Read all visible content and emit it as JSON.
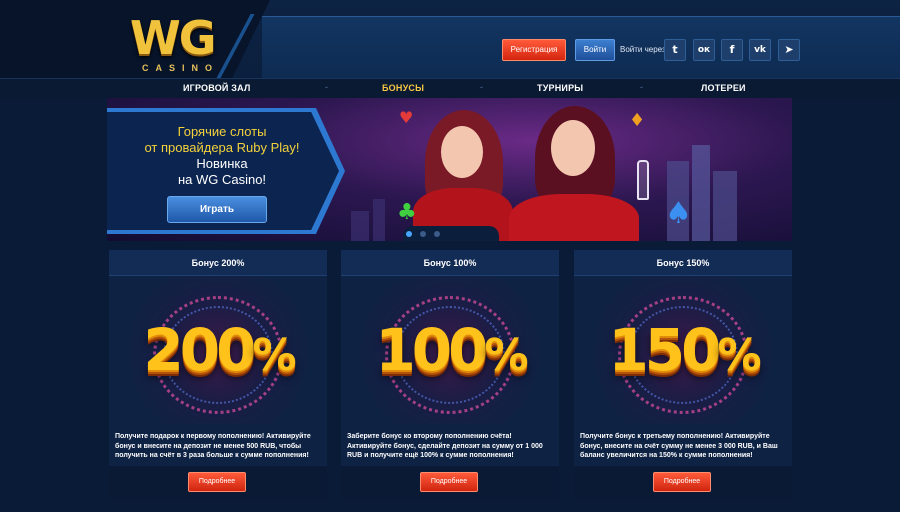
{
  "brand": {
    "logo_main": "WG",
    "logo_sub": "CASINO",
    "gold": "#f1c33d"
  },
  "header": {
    "register_label": "Регистрация",
    "login_label": "Войти",
    "login_via_label": "Войти через",
    "socials": [
      {
        "name": "twitter",
        "glyph": "t"
      },
      {
        "name": "odnoklassniki",
        "glyph": "ок"
      },
      {
        "name": "facebook",
        "glyph": "f"
      },
      {
        "name": "vkontakte",
        "glyph": "vk"
      },
      {
        "name": "telegram",
        "glyph": "➤"
      }
    ]
  },
  "nav": {
    "items": [
      {
        "label": "ИГРОВОЙ ЗАЛ",
        "active": false
      },
      {
        "label": "БОНУСЫ",
        "active": true
      },
      {
        "label": "ТУРНИРЫ",
        "active": false
      },
      {
        "label": "ЛОТЕРЕИ",
        "active": false
      }
    ],
    "separator": "-"
  },
  "banner": {
    "line1": "Горячие слоты",
    "line2": "от провайдера Ruby Play!",
    "line3": "Новинка",
    "line4": "на WG Casino!",
    "play_label": "Играть",
    "slides_count": 3,
    "active_slide": 1
  },
  "bonuses": [
    {
      "title": "Бонус 200%",
      "big_number": "200",
      "big_suffix": "%",
      "text": "Получите подарок к первому пополнению! Активируйте бонус и внесите на депозит не менее 500 RUB, чтобы получить на счёт в 3 раза больше к сумме пополнения!",
      "button": "Подробнее"
    },
    {
      "title": "Бонус 100%",
      "big_number": "100",
      "big_suffix": "%",
      "text": "Заберите бонус ко второму пополнению счёта! Активируйте бонус, сделайте депозит на сумму от 1 000 RUB и получите ещё 100% к сумме пополнения!",
      "button": "Подробнее"
    },
    {
      "title": "Бонус 150%",
      "big_number": "150",
      "big_suffix": "%",
      "text": "Получите бонус к третьему пополнению! Активируйте бонус, внесите на счёт сумму не менее 3 000 RUB, и Ваш баланс увеличится на 150% к сумме пополнения!",
      "button": "Подробнее"
    }
  ],
  "colors": {
    "accent_red": "#e0361c",
    "accent_blue": "#2d6fc4",
    "nav_active": "#f6c744",
    "background": "#0a1b38"
  }
}
